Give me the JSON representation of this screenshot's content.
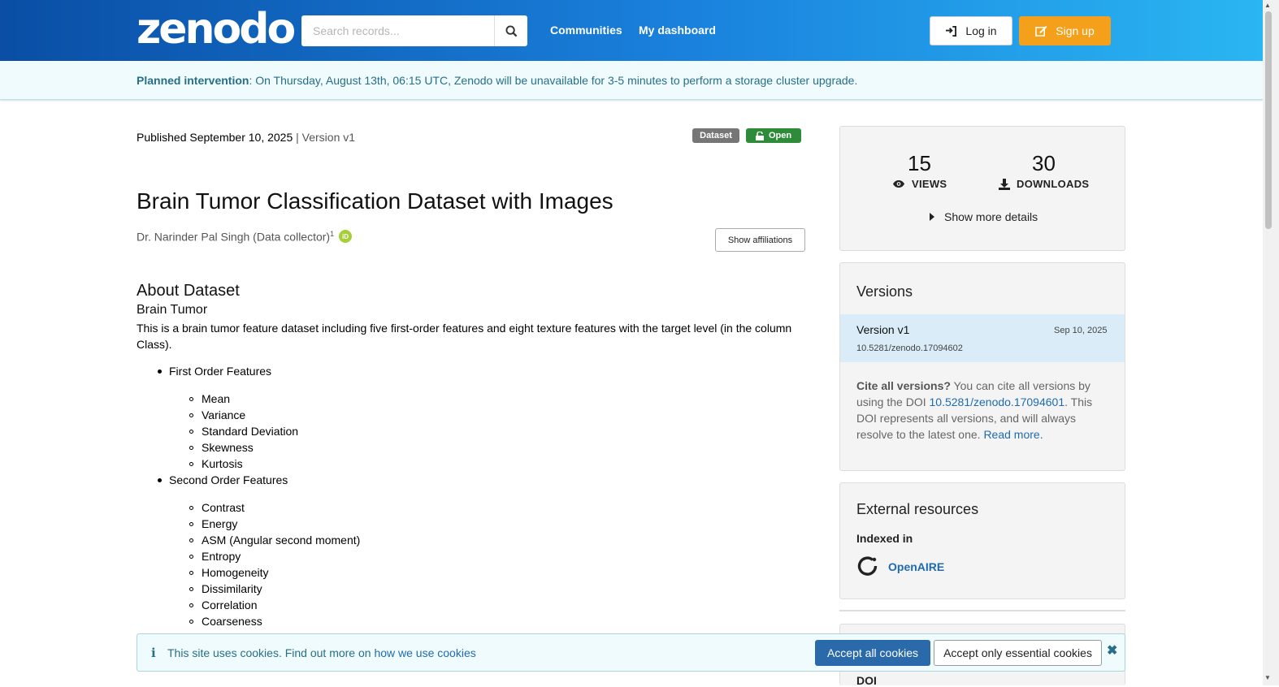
{
  "header": {
    "logo": "zenodo",
    "search_placeholder": "Search records...",
    "nav": [
      "Communities",
      "My dashboard"
    ],
    "login": "Log in",
    "signup": "Sign up"
  },
  "banner": {
    "strong": "Planned intervention",
    "text": ": On Thursday, August 13th, 06:15 UTC, Zenodo will be unavailable for 3-5 minutes to perform a storage cluster upgrade."
  },
  "record": {
    "published": "Published September 10, 2025",
    "sep": " | ",
    "version": "Version v1",
    "badge_type": "Dataset",
    "badge_access": "Open",
    "title": "Brain Tumor Classification Dataset with Images",
    "creator": "Dr. Narinder Pal Singh (Data collector)",
    "creator_sup": "1",
    "show_affiliations": "Show affiliations"
  },
  "description": {
    "h1": "About Dataset",
    "h2": "Brain Tumor",
    "para": "This is a brain tumor feature dataset including five first-order features and eight texture features with the target level (in the column Class).",
    "groups": [
      {
        "label": "First Order Features",
        "items": [
          "Mean",
          "Variance",
          "Standard Deviation",
          "Skewness",
          "Kurtosis"
        ]
      },
      {
        "label": "Second Order Features",
        "items": [
          "Contrast",
          "Energy",
          "ASM (Angular second moment)",
          "Entropy",
          "Homogeneity",
          "Dissimilarity",
          "Correlation",
          "Coarseness"
        ]
      }
    ]
  },
  "stats": {
    "views": "15",
    "views_label": "VIEWS",
    "downloads": "30",
    "downloads_label": "DOWNLOADS",
    "more": "Show more details"
  },
  "versions": {
    "heading": "Versions",
    "name": "Version v1",
    "date": "Sep 10, 2025",
    "doi": "10.5281/zenodo.17094602",
    "cite_strong": "Cite all versions?",
    "cite_1": " You can cite all versions by using the DOI ",
    "cite_doi": "10.5281/zenodo.17094601",
    "cite_2": ". This DOI represents all versions, and will always resolve to the latest one. ",
    "read_more": "Read more."
  },
  "external": {
    "heading": "External resources",
    "indexed": "Indexed in",
    "openaire": "OpenAIRE"
  },
  "doi_label": "DOI",
  "cookie": {
    "text": "This site uses cookies. Find out more on ",
    "link": "how we use cookies",
    "accept_all": "Accept all cookies",
    "accept_essential": "Accept only essential cookies"
  },
  "colors": {
    "header_start": "#0a4ea5",
    "header_end": "#2ab6f2",
    "signup": "#f5a01a",
    "badge_dataset": "#767676",
    "badge_open": "#2e8b3a",
    "link": "#1e6bb0"
  }
}
